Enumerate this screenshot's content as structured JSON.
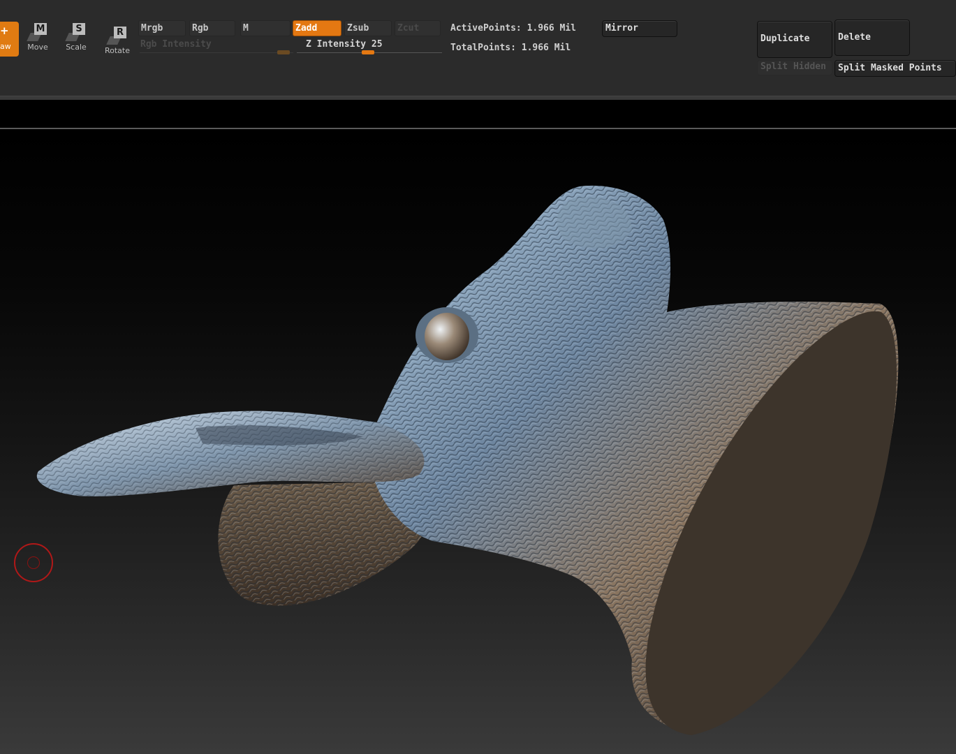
{
  "shelf": {
    "tools": {
      "draw": {
        "label": "aw",
        "glyph": "+"
      },
      "move": {
        "label": "Move",
        "letter": "M"
      },
      "scale": {
        "label": "Scale",
        "letter": "S"
      },
      "rotate": {
        "label": "Rotate",
        "letter": "R"
      }
    },
    "modes": {
      "mrgb": "Mrgb",
      "rgb": "Rgb",
      "m": "M",
      "zadd": "Zadd",
      "zsub": "Zsub",
      "zcut": "Zcut"
    },
    "rgb_intensity": {
      "label": "Rgb Intensity"
    },
    "z_intensity": {
      "label": "Z Intensity 25",
      "value": 25
    },
    "stats": {
      "active_points": "ActivePoints: 1.966 Mil",
      "total_points": "TotalPoints: 1.966 Mil"
    },
    "subtool": {
      "mirror": "Mirror",
      "duplicate": "Duplicate",
      "delete": "Delete",
      "split_hidden": "Split Hidden",
      "split_masked_points": "Split Masked Points"
    },
    "colors": {
      "accent": "#e47812",
      "shelf_bg": "#2b2b2b"
    }
  },
  "viewport": {
    "model": "rabbit-head-sculpt",
    "brush_cursor": "brush-circle"
  }
}
